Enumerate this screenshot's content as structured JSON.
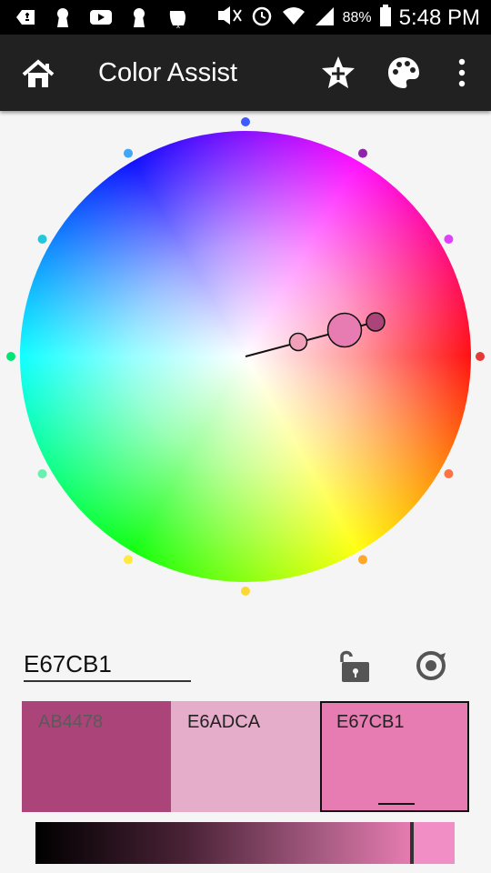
{
  "status_bar": {
    "battery": "88%",
    "time": "5:48 PM"
  },
  "app_bar": {
    "title": "Color Assist",
    "icons": [
      "home-icon",
      "add-favorite-icon",
      "palette-icon",
      "more-vert-icon"
    ]
  },
  "color_input": {
    "value": "E67CB1"
  },
  "swatches": [
    {
      "hex": "AB4478",
      "color": "#ab4478",
      "text_color": "#5a5a5a"
    },
    {
      "hex": "E6ADCA",
      "color": "#e6adca",
      "text_color": "#222222"
    },
    {
      "hex": "E67CB1",
      "color": "#e67cb1",
      "text_color": "#222222",
      "selected": true
    }
  ],
  "shade_slider": {
    "color": "#e67cb1",
    "tail_color": "#f08ec5",
    "value": 0.93
  },
  "wheel": {
    "markers": [
      {
        "angle": 0,
        "color": "#e53935"
      },
      {
        "angle": 30,
        "color": "#e040fb"
      },
      {
        "angle": 60,
        "color": "#8e24aa"
      },
      {
        "angle": 90,
        "color": "#3d5afe"
      },
      {
        "angle": 120,
        "color": "#42a5f5"
      },
      {
        "angle": 150,
        "color": "#26c6da"
      },
      {
        "angle": 180,
        "color": "#00e676"
      },
      {
        "angle": 210,
        "color": "#69f0ae"
      },
      {
        "angle": 240,
        "color": "#ffeb3b"
      },
      {
        "angle": 270,
        "color": "#fdd835"
      },
      {
        "angle": 300,
        "color": "#ffa726"
      },
      {
        "angle": 330,
        "color": "#ff7043"
      }
    ]
  }
}
